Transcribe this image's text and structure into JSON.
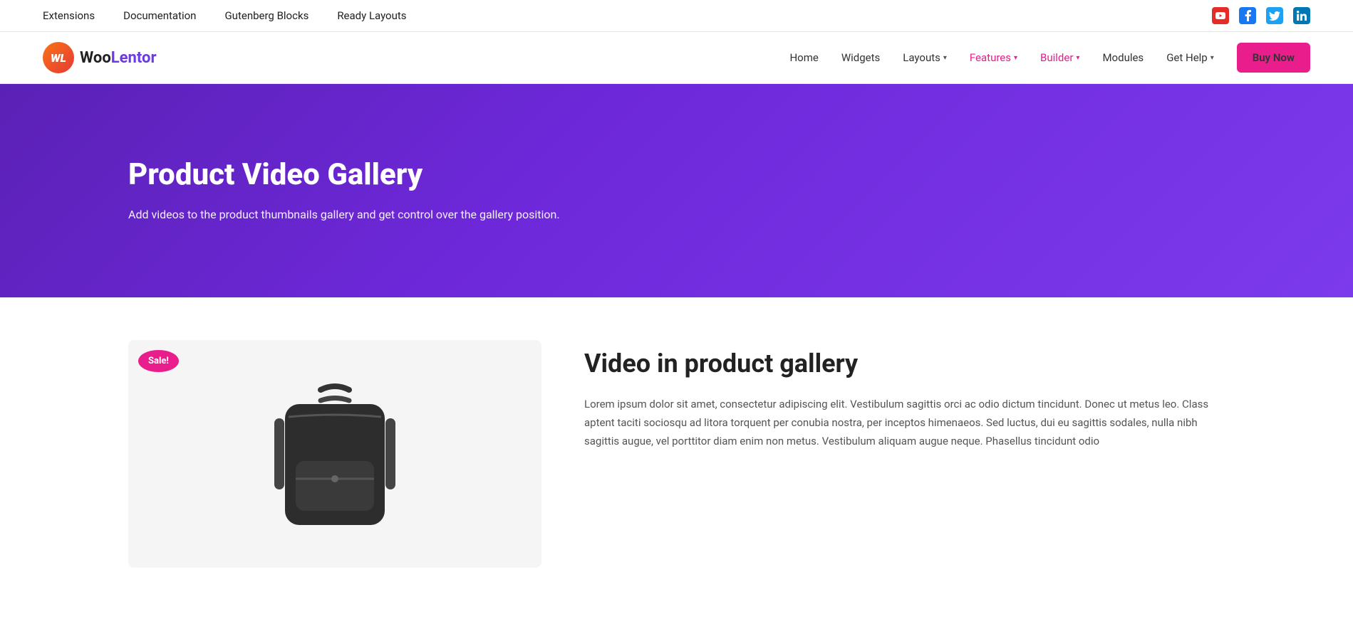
{
  "topbar": {
    "nav": [
      {
        "label": "Extensions",
        "url": "#"
      },
      {
        "label": "Documentation",
        "url": "#"
      },
      {
        "label": "Gutenberg Blocks",
        "url": "#"
      },
      {
        "label": "Ready Layouts",
        "url": "#"
      }
    ],
    "social": [
      {
        "name": "youtube",
        "icon": "▶",
        "color": "#e52d27",
        "label": "YouTube"
      },
      {
        "name": "facebook",
        "icon": "f",
        "color": "#1877f2",
        "label": "Facebook"
      },
      {
        "name": "twitter",
        "icon": "🐦",
        "color": "#1da1f2",
        "label": "Twitter"
      },
      {
        "name": "linkedin",
        "icon": "in",
        "color": "#0077b5",
        "label": "LinkedIn"
      }
    ]
  },
  "mainnav": {
    "logo_text_woo": "Woo",
    "logo_text_lentor": "Lentor",
    "logo_initials": "WL",
    "links": [
      {
        "label": "Home",
        "url": "#",
        "active": false
      },
      {
        "label": "Widgets",
        "url": "#",
        "active": false
      },
      {
        "label": "Layouts",
        "url": "#",
        "active": false,
        "has_arrow": true
      },
      {
        "label": "Features",
        "url": "#",
        "active": true,
        "color": "pink",
        "has_arrow": true
      },
      {
        "label": "Builder",
        "url": "#",
        "active": true,
        "color": "pink",
        "has_arrow": true
      },
      {
        "label": "Modules",
        "url": "#",
        "active": false
      },
      {
        "label": "Get Help",
        "url": "#",
        "active": false,
        "has_arrow": true
      }
    ],
    "buy_now": "Buy Now"
  },
  "hero": {
    "title": "Product Video Gallery",
    "description": "Add videos to the product thumbnails gallery and get control over the gallery position."
  },
  "product": {
    "sale_badge": "Sale!",
    "info_title": "Video in product gallery",
    "info_text": "Lorem ipsum dolor sit amet, consectetur adipiscing elit. Vestibulum sagittis orci ac odio dictum tincidunt. Donec ut metus leo. Class aptent taciti sociosqu ad litora torquent per conubia nostra, per inceptos himenaeos. Sed luctus, dui eu sagittis sodales, nulla nibh sagittis augue, vel porttitor diam enim non metus. Vestibulum aliquam augue neque. Phasellus tincidunt odio"
  }
}
